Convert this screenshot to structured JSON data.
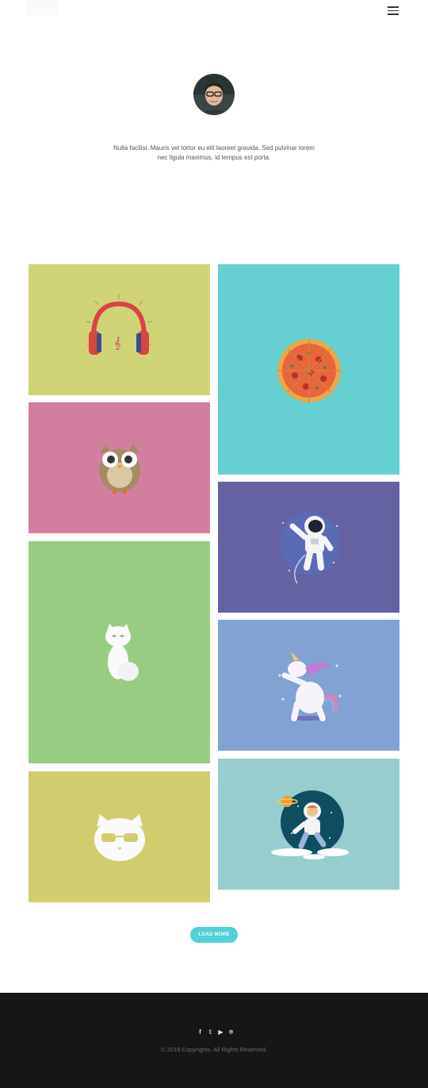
{
  "header": {
    "menu_icon": "hamburger-menu-icon"
  },
  "profile": {
    "bio": "Nulla facilisi. Mauris vel tortor eu elit laoreet gravida. Sed pulvinar lorem nec ligula maximus, id tempus est porta."
  },
  "portfolio": {
    "items": [
      {
        "illustration": "headphones",
        "bg": "#d0d376"
      },
      {
        "illustration": "owl",
        "bg": "#d27f9f"
      },
      {
        "illustration": "white-cat",
        "bg": "#98cc82"
      },
      {
        "illustration": "cat-with-glasses",
        "bg": "#d3cc6f"
      },
      {
        "illustration": "pizza",
        "bg": "#65cfd2"
      },
      {
        "illustration": "astronaut",
        "bg": "#6462a2"
      },
      {
        "illustration": "dabbing-unicorn",
        "bg": "#82a2d3"
      },
      {
        "illustration": "kid-astronaut",
        "bg": "#97cdce"
      }
    ]
  },
  "load_more_label": "LOAD MORE",
  "footer": {
    "social": [
      "f",
      "𝕥",
      "▶",
      "⌾"
    ],
    "copyright": "© 2018 Copyrights. All Rights Reserved."
  },
  "colors": {
    "accent": "#4fd2d8",
    "footer_bg": "#151618"
  }
}
